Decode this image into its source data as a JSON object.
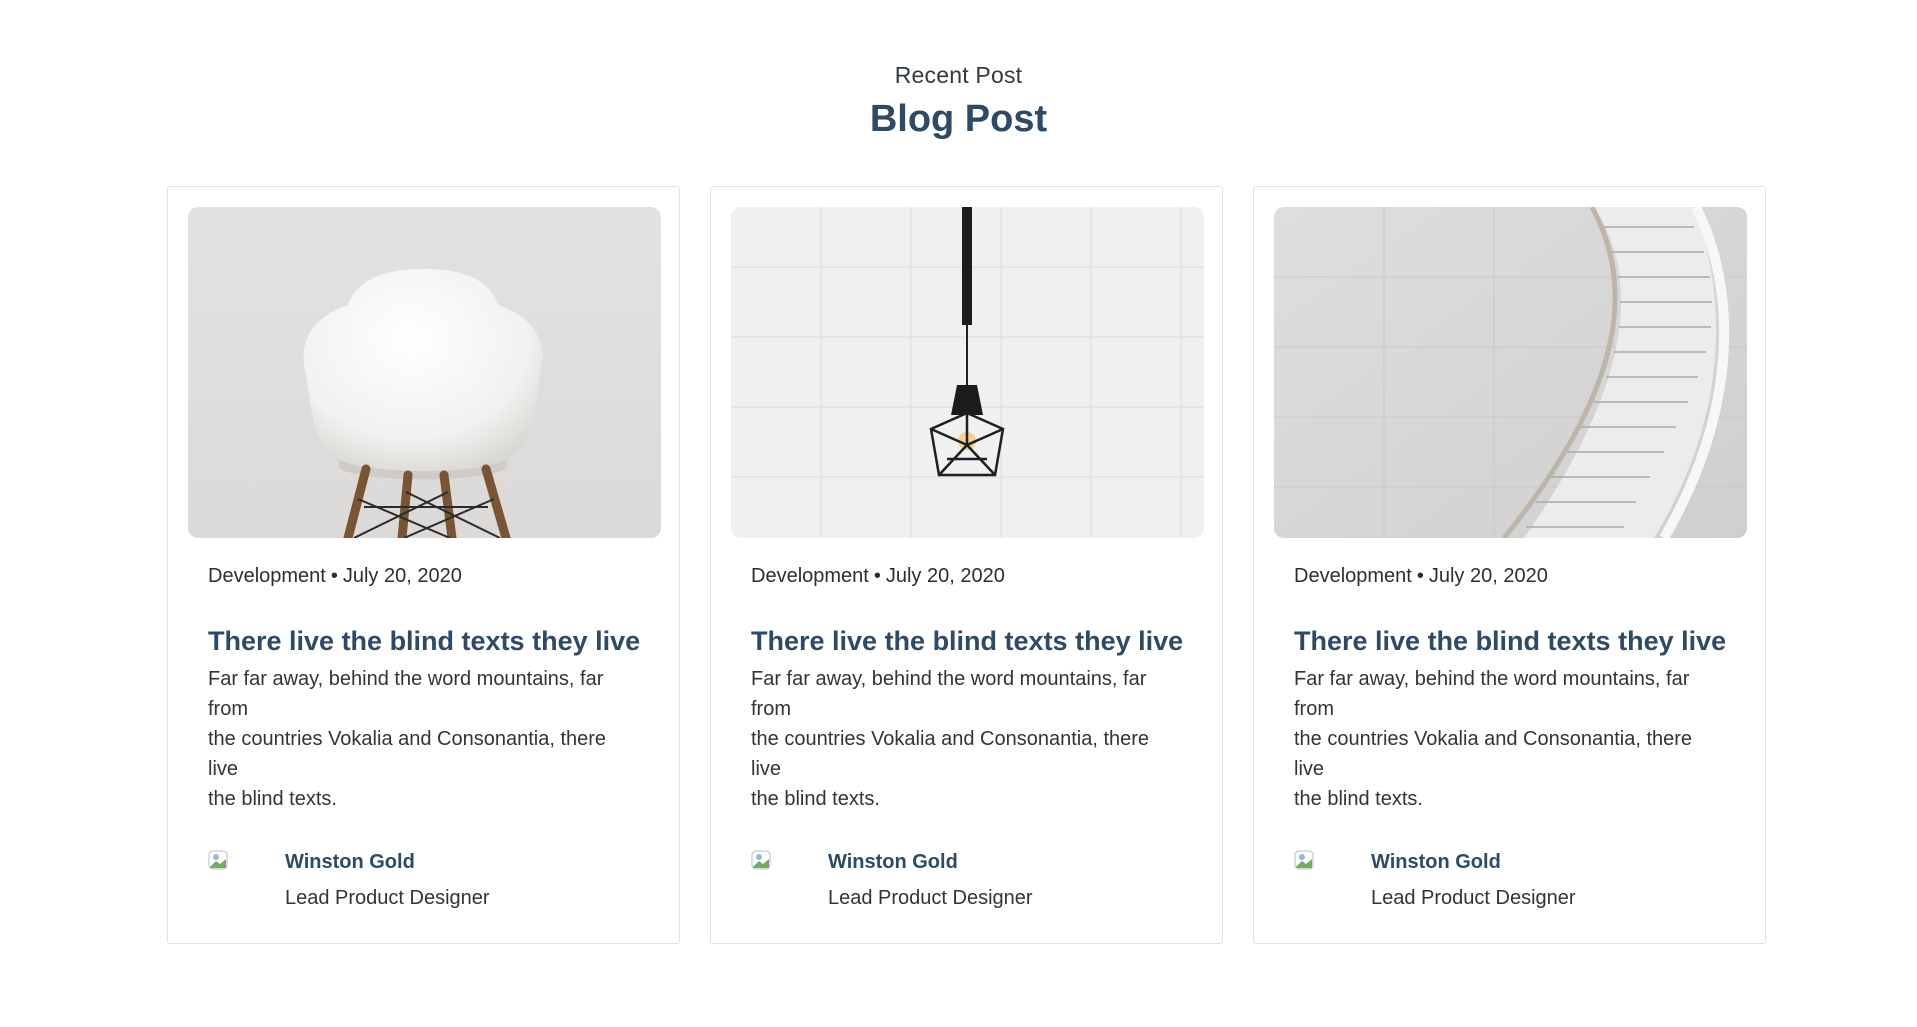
{
  "section": {
    "eyebrow": "Recent Post",
    "title": "Blog Post"
  },
  "posts": [
    {
      "image_icon": "chair-photo",
      "category": "Development",
      "separator": "•",
      "date": "July 20, 2020",
      "title": "There live the blind texts they live",
      "excerpt_lines": [
        "Far far away, behind the word mountains, far",
        "from",
        "the countries Vokalia and Consonantia, there",
        "live",
        "the blind texts."
      ],
      "author_name": "Winston Gold",
      "author_role": "Lead Product Designer"
    },
    {
      "image_icon": "pendant-lamp-photo",
      "category": "Development",
      "separator": "•",
      "date": "July 20, 2020",
      "title": "There live the blind texts they live",
      "excerpt_lines": [
        "Far far away, behind the word mountains, far",
        "from",
        "the countries Vokalia and Consonantia, there",
        "live",
        "the blind texts."
      ],
      "author_name": "Winston Gold",
      "author_role": "Lead Product Designer"
    },
    {
      "image_icon": "spiral-staircase-photo",
      "category": "Development",
      "separator": "•",
      "date": "July 20, 2020",
      "title": "There live the blind texts they live",
      "excerpt_lines": [
        "Far far away, behind the word mountains, far",
        "from",
        "the countries Vokalia and Consonantia, there",
        "live",
        "the blind texts."
      ],
      "author_name": "Winston Gold",
      "author_role": "Lead Product Designer"
    }
  ],
  "colors": {
    "heading": "#2e4a66",
    "body_text": "#2f353a",
    "card_border": "#dfe3e8"
  }
}
